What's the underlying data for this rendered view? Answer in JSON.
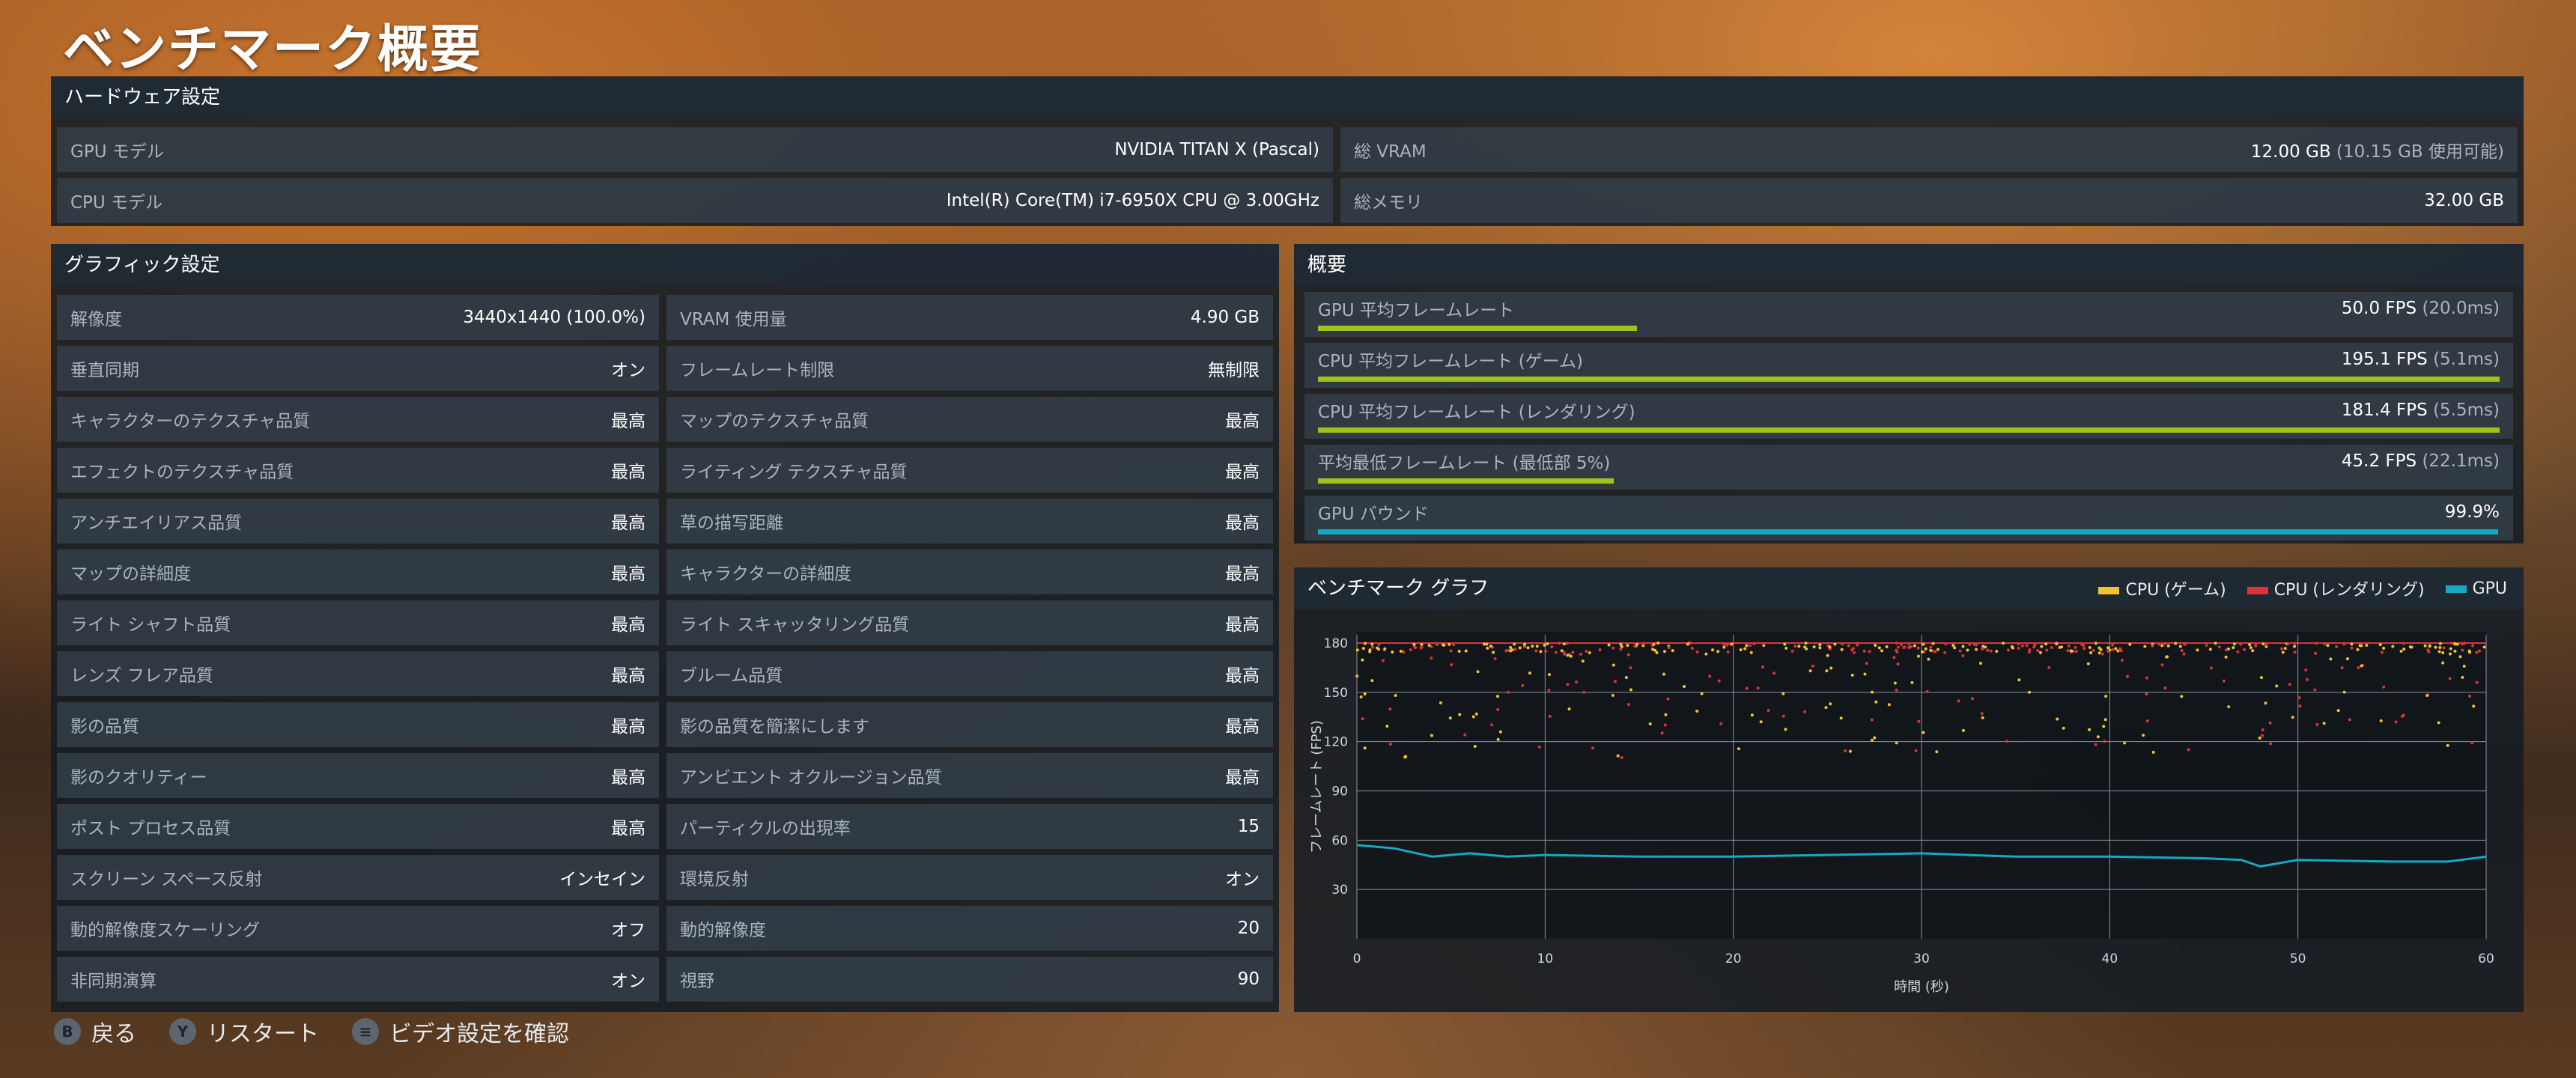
{
  "page_title": "ベンチマーク概要",
  "hardware": {
    "header": "ハードウェア設定",
    "gpu_label": "GPU モデル",
    "gpu_value": "NVIDIA TITAN X (Pascal)",
    "cpu_label": "CPU モデル",
    "cpu_value": "Intel(R) Core(TM) i7-6950X CPU @ 3.00GHz",
    "vram_label": "総 VRAM",
    "vram_value": "12.00 GB",
    "vram_sub": "(10.15 GB 使用可能)",
    "mem_label": "総メモリ",
    "mem_value": "32.00 GB"
  },
  "graphics": {
    "header": "グラフィック設定",
    "left": [
      {
        "label": "解像度",
        "value": "3440x1440 (100.0%)"
      },
      {
        "label": "垂直同期",
        "value": "オン"
      },
      {
        "label": "キャラクターのテクスチャ品質",
        "value": "最高"
      },
      {
        "label": "エフェクトのテクスチャ品質",
        "value": "最高"
      },
      {
        "label": "アンチエイリアス品質",
        "value": "最高"
      },
      {
        "label": "マップの詳細度",
        "value": "最高"
      },
      {
        "label": "ライト シャフト品質",
        "value": "最高"
      },
      {
        "label": "レンズ フレア品質",
        "value": "最高"
      },
      {
        "label": "影の品質",
        "value": "最高"
      },
      {
        "label": "影のクオリティー",
        "value": "最高"
      },
      {
        "label": "ポスト プロセス品質",
        "value": "最高"
      },
      {
        "label": "スクリーン スペース反射",
        "value": "インセイン"
      },
      {
        "label": "動的解像度スケーリング",
        "value": "オフ"
      },
      {
        "label": "非同期演算",
        "value": "オン"
      }
    ],
    "right": [
      {
        "label": "VRAM 使用量",
        "value": "4.90 GB"
      },
      {
        "label": "フレームレート制限",
        "value": "無制限"
      },
      {
        "label": "マップのテクスチャ品質",
        "value": "最高"
      },
      {
        "label": "ライティング テクスチャ品質",
        "value": "最高"
      },
      {
        "label": "草の描写距離",
        "value": "最高"
      },
      {
        "label": "キャラクターの詳細度",
        "value": "最高"
      },
      {
        "label": "ライト スキャッタリング品質",
        "value": "最高"
      },
      {
        "label": "ブルーム品質",
        "value": "最高"
      },
      {
        "label": "影の品質を簡潔にします",
        "value": "最高"
      },
      {
        "label": "アンビエント オクルージョン品質",
        "value": "最高"
      },
      {
        "label": "パーティクルの出現率",
        "value": "15"
      },
      {
        "label": "環境反射",
        "value": "オン"
      },
      {
        "label": "動的解像度",
        "value": "20"
      },
      {
        "label": "視野",
        "value": "90"
      }
    ]
  },
  "summary": {
    "header": "概要",
    "rows": [
      {
        "label": "GPU 平均フレームレート",
        "value": "50.0 FPS",
        "sub": "(20.0ms)",
        "fill": 0.27,
        "color": "#9fc21e"
      },
      {
        "label": "CPU 平均フレームレート (ゲーム)",
        "value": "195.1 FPS",
        "sub": "(5.1ms)",
        "fill": 1.0,
        "color": "#9fc21e"
      },
      {
        "label": "CPU 平均フレームレート (レンダリング)",
        "value": "181.4 FPS",
        "sub": "(5.5ms)",
        "fill": 1.0,
        "color": "#9fc21e"
      },
      {
        "label": "平均最低フレームレート (最低部 5%)",
        "value": "45.2 FPS",
        "sub": "(22.1ms)",
        "fill": 0.25,
        "color": "#9fc21e"
      },
      {
        "label": "GPU バウンド",
        "value": "99.9%",
        "sub": "",
        "fill": 0.999,
        "color": "#17a8c4"
      }
    ]
  },
  "graph": {
    "header": "ベンチマーク グラフ",
    "legend": [
      {
        "name": "CPU (ゲーム)",
        "color": "#f2c230"
      },
      {
        "name": "CPU (レンダリング)",
        "color": "#e0303a"
      },
      {
        "name": "GPU",
        "color": "#17a8c4"
      }
    ]
  },
  "chart_data": {
    "type": "scatter",
    "xlabel": "時間 (秒)",
    "ylabel": "フレームレート (FPS)",
    "xlim": [
      0,
      60
    ],
    "ylim": [
      0,
      185
    ],
    "xticks": [
      0,
      10,
      20,
      30,
      40,
      50,
      60
    ],
    "yticks": [
      30,
      60,
      90,
      120,
      150,
      180
    ],
    "grid": true,
    "series": [
      {
        "name": "CPU (ゲーム)",
        "color": "#f2c230",
        "note_values": "scattered points mostly between 110 and 180 FPS"
      },
      {
        "name": "CPU (レンダリング)",
        "color": "#e0303a",
        "note_values": "mostly capped at 180 FPS with scattered dips to 120–175"
      },
      {
        "name": "GPU",
        "color": "#17a8c4",
        "x": [
          0,
          2,
          4,
          6,
          8,
          10,
          15,
          20,
          25,
          30,
          35,
          40,
          45,
          47,
          48,
          50,
          55,
          58,
          60
        ],
        "y": [
          57,
          55,
          50,
          52,
          50,
          51,
          50,
          50,
          51,
          52,
          50,
          50,
          49,
          48,
          44,
          48,
          47,
          47,
          50
        ]
      }
    ]
  },
  "footer": [
    {
      "key": "B",
      "label": "戻る"
    },
    {
      "key": "Y",
      "label": "リスタート"
    },
    {
      "key": "≡",
      "label": "ビデオ設定を確認"
    }
  ]
}
